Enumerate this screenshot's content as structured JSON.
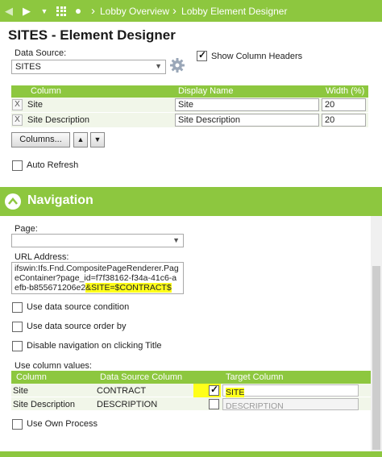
{
  "nav": {
    "breadcrumbs": [
      "Lobby Overview",
      "Lobby Element Designer"
    ]
  },
  "page": {
    "title": "SITES - Element Designer"
  },
  "data_source": {
    "label": "Data Source:",
    "value": "SITES",
    "show_column_headers_label": "Show Column Headers",
    "show_column_headers_checked": true
  },
  "columns_table": {
    "headers": {
      "column": "Column",
      "display_name": "Display Name",
      "width": "Width (%)"
    },
    "rows": [
      {
        "column": "Site",
        "display_name": "Site",
        "width": "20"
      },
      {
        "column": "Site Description",
        "display_name": "Site Description",
        "width": "20"
      }
    ],
    "remove_symbol": "X"
  },
  "columns_button": {
    "label": "Columns...",
    "move_up": "▲",
    "move_down": "▼"
  },
  "auto_refresh": {
    "label": "Auto Refresh",
    "checked": false
  },
  "navigation": {
    "title": "Navigation",
    "page_label": "Page:",
    "page_value": "",
    "url_label": "URL Address:",
    "url_main": "ifswin:Ifs.Fnd.CompositePageRenderer.PageContainer?page_id=f7f38162-f34a-41c6-aefb-b855671206e2",
    "url_highlight": "&SITE=$CONTRACT$",
    "options": [
      {
        "label": "Use data source condition",
        "checked": false
      },
      {
        "label": "Use data source order by",
        "checked": false
      },
      {
        "label": "Disable navigation on clicking Title",
        "checked": false
      }
    ],
    "use_column_values_label": "Use column values:",
    "column_values_table": {
      "headers": {
        "column": "Column",
        "data_source_column": "Data Source Column",
        "target_column": "Target Column"
      },
      "rows": [
        {
          "column": "Site",
          "data_source_column": "CONTRACT",
          "checked": true,
          "target": "SITE"
        },
        {
          "column": "Site Description",
          "data_source_column": "DESCRIPTION",
          "checked": false,
          "target": "DESCRIPTION"
        }
      ]
    },
    "use_own_process": {
      "label": "Use Own Process",
      "checked": false
    }
  },
  "colors": {
    "accent": "#8dc73f",
    "highlight": "#ffff1a"
  }
}
